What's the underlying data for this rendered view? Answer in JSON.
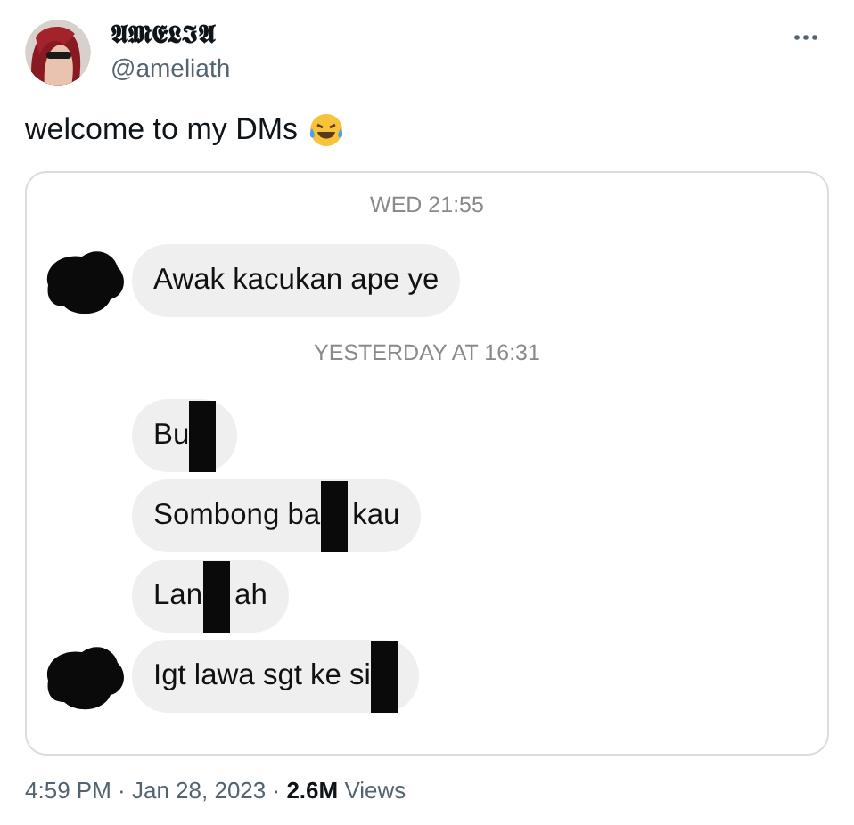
{
  "tweet": {
    "author": {
      "display_name": "𝕬𝕸𝕰𝕷𝕴𝕬",
      "handle": "@ameliath"
    },
    "text": "welcome to my DMs",
    "chat": [
      {
        "kind": "timestamp",
        "text": "WED 21:55"
      },
      {
        "kind": "message",
        "avatar": true,
        "parts": [
          {
            "kind": "text",
            "text": "Awak kacukan ape ye"
          }
        ]
      },
      {
        "kind": "timestamp",
        "text": "YESTERDAY AT 16:31"
      },
      {
        "kind": "message",
        "avatar": false,
        "parts": [
          {
            "kind": "text",
            "text": "Bu"
          },
          {
            "kind": "redaction"
          }
        ]
      },
      {
        "kind": "message",
        "avatar": false,
        "parts": [
          {
            "kind": "text",
            "text": "Sombong ba"
          },
          {
            "kind": "redaction"
          },
          {
            "kind": "text",
            "text": "kau"
          }
        ]
      },
      {
        "kind": "message",
        "avatar": false,
        "parts": [
          {
            "kind": "text",
            "text": "Lan"
          },
          {
            "kind": "redaction"
          },
          {
            "kind": "text",
            "text": "ah"
          }
        ]
      },
      {
        "kind": "message",
        "avatar": true,
        "parts": [
          {
            "kind": "text",
            "text": "Igt lawa sgt ke si"
          },
          {
            "kind": "redaction"
          }
        ]
      }
    ],
    "meta": "4:59 PM · Jan 28, 2023 · **2.6M** Views"
  }
}
